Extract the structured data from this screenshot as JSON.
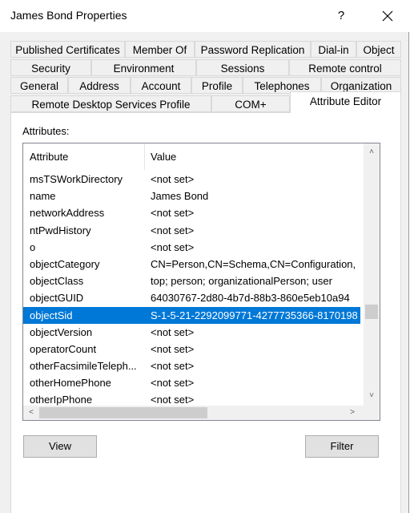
{
  "window": {
    "title": "James Bond Properties",
    "help_label": "?"
  },
  "tabs": {
    "row1": [
      "Published Certificates",
      "Member Of",
      "Password Replication",
      "Dial-in",
      "Object"
    ],
    "row2": [
      "Security",
      "Environment",
      "Sessions",
      "Remote control"
    ],
    "row3": [
      "General",
      "Address",
      "Account",
      "Profile",
      "Telephones",
      "Organization"
    ],
    "row4": [
      "Remote Desktop Services Profile",
      "COM+",
      "Attribute Editor"
    ],
    "active": "Attribute Editor"
  },
  "attributes_label": "Attributes:",
  "list": {
    "columns": [
      "Attribute",
      "Value"
    ],
    "rows": [
      {
        "attribute": "msTSWorkDirectory",
        "value": "<not set>"
      },
      {
        "attribute": "name",
        "value": "James Bond"
      },
      {
        "attribute": "networkAddress",
        "value": "<not set>"
      },
      {
        "attribute": "ntPwdHistory",
        "value": "<not set>"
      },
      {
        "attribute": "o",
        "value": "<not set>"
      },
      {
        "attribute": "objectCategory",
        "value": "CN=Person,CN=Schema,CN=Configuration,"
      },
      {
        "attribute": "objectClass",
        "value": "top; person; organizationalPerson; user"
      },
      {
        "attribute": "objectGUID",
        "value": "64030767-2d80-4b7d-88b3-860e5eb10a94"
      },
      {
        "attribute": "objectSid",
        "value": "S-1-5-21-2292099771-4277735366-8170198"
      },
      {
        "attribute": "objectVersion",
        "value": "<not set>"
      },
      {
        "attribute": "operatorCount",
        "value": "<not set>"
      },
      {
        "attribute": "otherFacsimileTeleph...",
        "value": "<not set>"
      },
      {
        "attribute": "otherHomePhone",
        "value": "<not set>"
      },
      {
        "attribute": "otherIpPhone",
        "value": "<not set>"
      }
    ],
    "selected_attribute": "objectSid"
  },
  "buttons": {
    "view": "View",
    "filter": "Filter"
  },
  "colors": {
    "selection": "#0078d7",
    "dialog_bg": "#f0f0f0"
  }
}
